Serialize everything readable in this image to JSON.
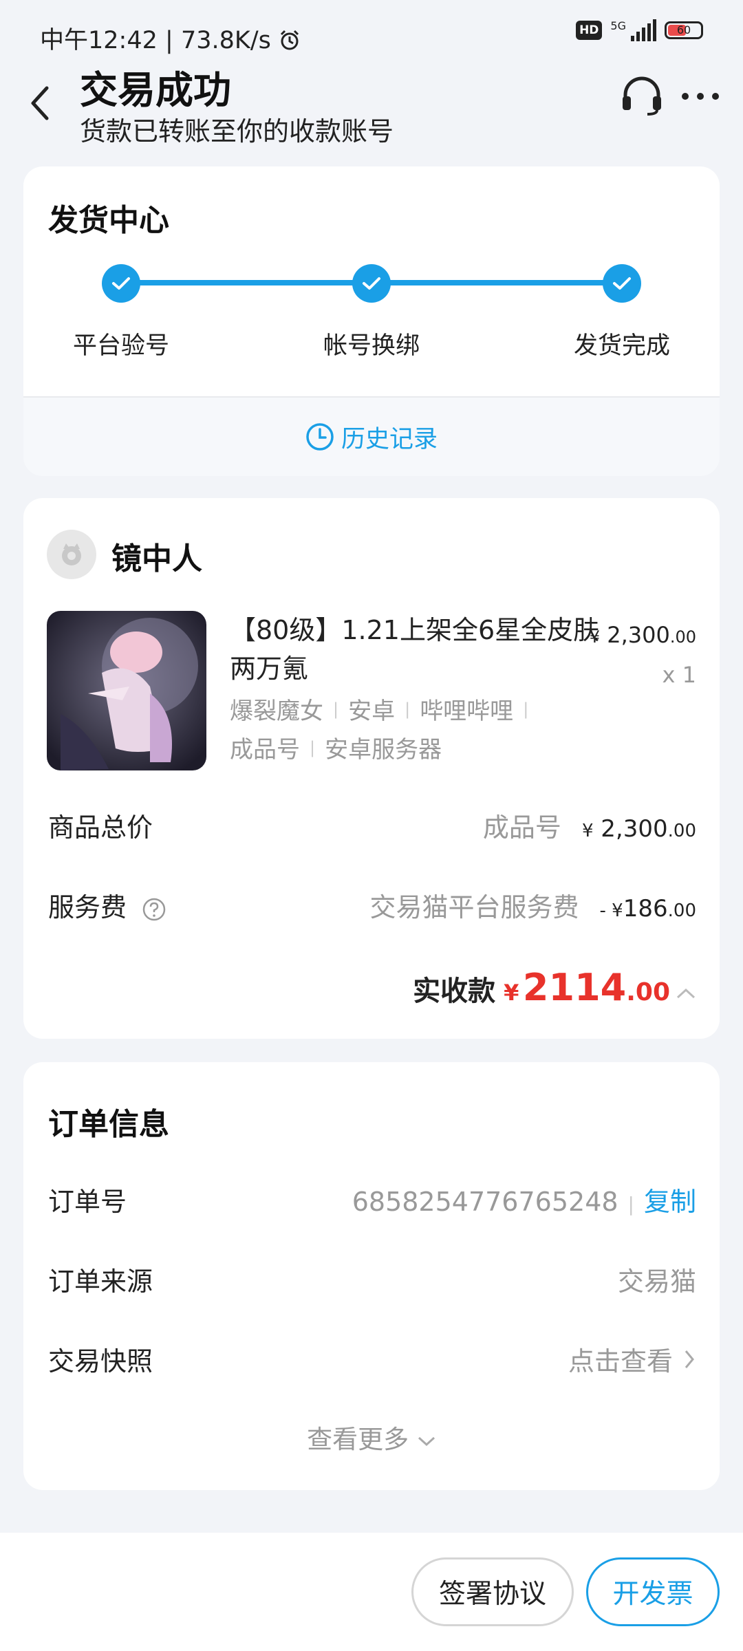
{
  "status_bar": {
    "time": "中午12:42",
    "network_speed": "73.8K/s",
    "hd": "HD",
    "signal": "5G",
    "battery": "60"
  },
  "header": {
    "title": "交易成功",
    "subtitle": "货款已转账至你的收款账号"
  },
  "shipping": {
    "title": "发货中心",
    "steps": [
      "平台验号",
      "帐号换绑",
      "发货完成"
    ],
    "history": "历史记录"
  },
  "product": {
    "seller": "镜中人",
    "title": "【80级】1.21上架全6星全皮肤两万氪",
    "price_symbol": "¥",
    "price_int": "2,300",
    "price_dec": ".00",
    "quantity": "x 1",
    "tags_line1": [
      "爆裂魔女",
      "安卓",
      "哔哩哔哩"
    ],
    "tags_line2": [
      "成品号",
      "安卓服务器"
    ],
    "total_label": "商品总价",
    "total_note": "成品号",
    "total_int": "2,300",
    "total_dec": ".00",
    "fee_label": "服务费",
    "fee_note": "交易猫平台服务费",
    "fee_prefix": "- ¥",
    "fee_int": "186",
    "fee_dec": ".00",
    "received_label": "实收款",
    "received_symbol": "¥",
    "received_int": "2114",
    "received_dec": ".00"
  },
  "order": {
    "title": "订单信息",
    "rows": [
      {
        "label": "订单号",
        "value": "6858254776765248",
        "action": "复制"
      },
      {
        "label": "订单来源",
        "value": "交易猫"
      },
      {
        "label": "交易快照",
        "value": "点击查看"
      }
    ],
    "see_more": "查看更多"
  },
  "bottom_bar": {
    "sign_label": "签署协议",
    "invoice_label": "开发票"
  },
  "colors": {
    "accent": "#1a9fe6",
    "price_red": "#e8322b",
    "background": "#f2f4f8"
  }
}
